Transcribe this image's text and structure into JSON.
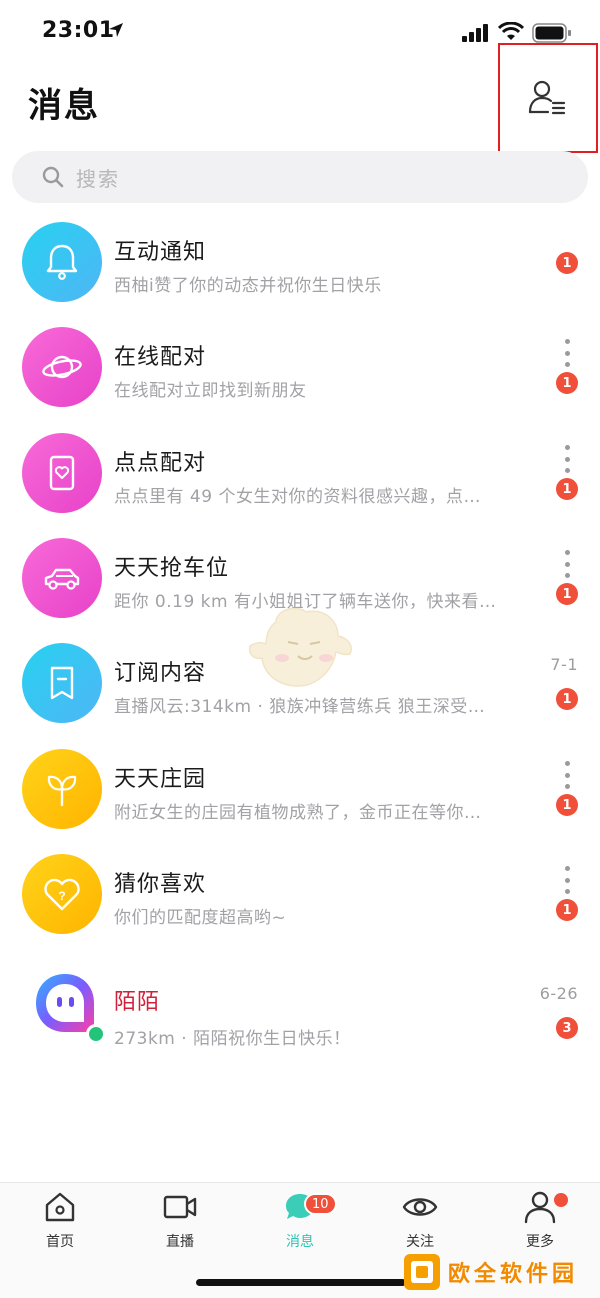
{
  "status_bar": {
    "time": "23:01"
  },
  "header": {
    "title": "消息"
  },
  "search": {
    "placeholder": "搜索"
  },
  "colors": {
    "badge": "#f04f3a",
    "active_tab": "#2cc4b3",
    "accent_red": "#d0203a",
    "online": "#22c47a"
  },
  "messages": [
    {
      "title": "互动通知",
      "preview": "西柚i赞了你的动态并祝你生日快乐",
      "badge": "1",
      "icon": "bell-icon"
    },
    {
      "title": "在线配对",
      "preview": "在线配对立即找到新朋友",
      "badge": "1",
      "icon": "planet-icon"
    },
    {
      "title": "点点配对",
      "preview": "点点里有 49 个女生对你的资料很感兴趣，点…",
      "badge": "1",
      "icon": "heart-card-icon"
    },
    {
      "title": "天天抢车位",
      "preview": "距你 0.19 km 有小姐姐订了辆车送你，快来看…",
      "badge": "1",
      "icon": "car-icon"
    },
    {
      "title": "订阅内容",
      "preview": "直播风云:314km · 狼族冲锋营练兵 狼王深受…",
      "badge": "1",
      "time": "7-1",
      "icon": "bookmark-icon"
    },
    {
      "title": "天天庄园",
      "preview": "附近女生的庄园有植物成熟了，金币正在等你…",
      "badge": "1",
      "icon": "sprout-icon"
    },
    {
      "title": "猜你喜欢",
      "preview": "你们的匹配度超高哟~",
      "badge": "1",
      "icon": "heart-question-icon"
    },
    {
      "title": "陌陌",
      "preview": "273km · 陌陌祝你生日快乐！",
      "badge": "3",
      "time": "6-26",
      "icon": "momo-logo"
    }
  ],
  "tabs": [
    {
      "label": "首页",
      "icon": "home-icon"
    },
    {
      "label": "直播",
      "icon": "video-icon"
    },
    {
      "label": "消息",
      "icon": "chat-icon",
      "badge": "10",
      "active": true
    },
    {
      "label": "关注",
      "icon": "eye-icon"
    },
    {
      "label": "更多",
      "icon": "person-icon"
    }
  ],
  "watermark": {
    "text": "欧全软件园"
  }
}
